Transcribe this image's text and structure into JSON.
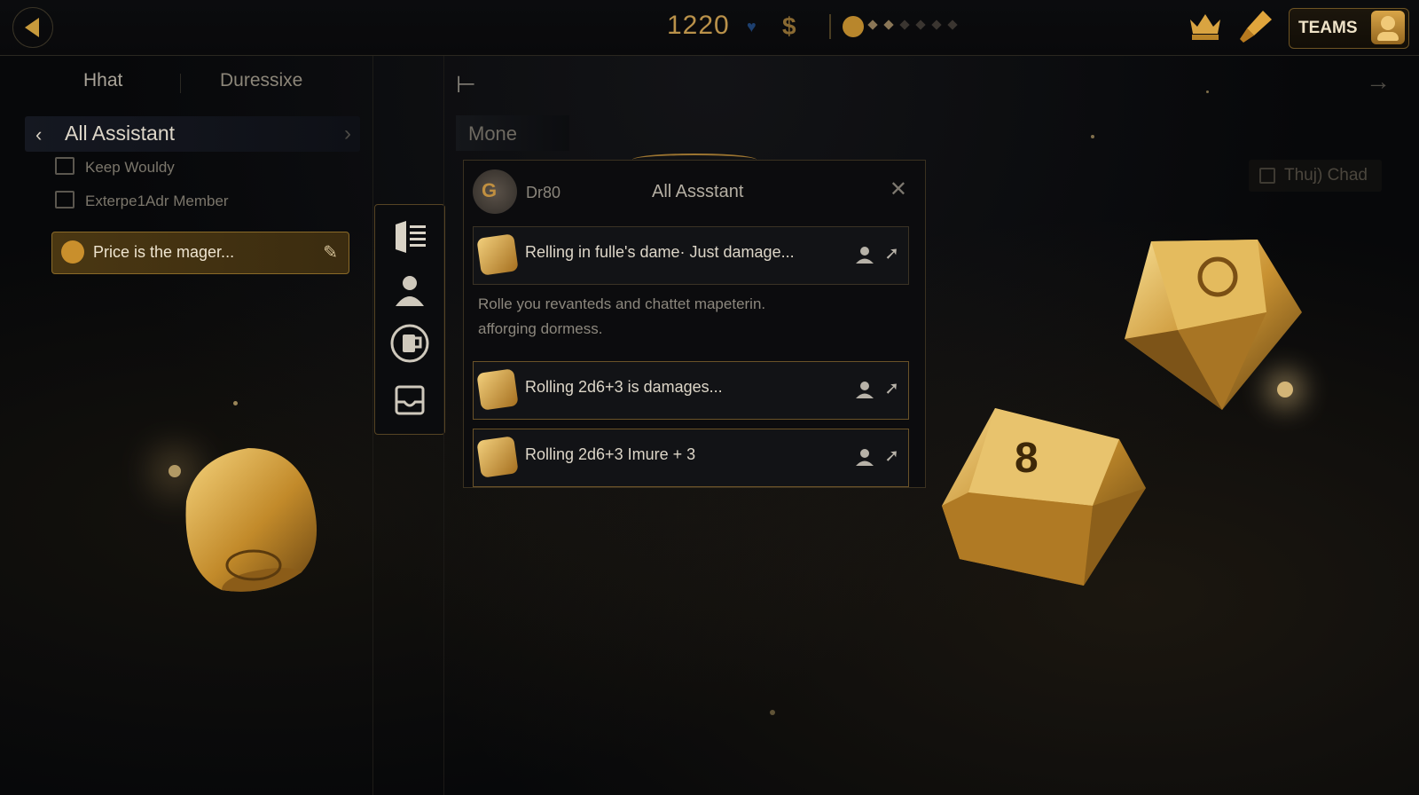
{
  "topbar": {
    "score": "1220",
    "icons": [
      "back-icon",
      "heart-icon",
      "dollar-icon",
      "face-icon",
      "crown-icon",
      "brush-icon"
    ],
    "teams_label": "TEAMS"
  },
  "sidebar": {
    "tabs": [
      "Hhat",
      "Duressixe"
    ],
    "assistant_title": "All Assistant",
    "items": [
      {
        "label": "Keep Wouldy"
      },
      {
        "label": "Exterpe1Adr Member"
      }
    ],
    "highlight": "Price is the mager..."
  },
  "main": {
    "mone": "Mone",
    "thuj": "Thuj) Chad"
  },
  "chat": {
    "user": "Dr80",
    "title": "All Assstant",
    "messages": [
      {
        "text": "Relling in fulle's dame· Just damage..."
      },
      {
        "text": "Rolling 2d6+3 is damages..."
      },
      {
        "text": "Rolling 2d6+3 Imure + 3"
      }
    ],
    "body_line1": "Rolle you revanteds and chattet mapeterin.",
    "body_line2": "afforging dormess."
  },
  "colors": {
    "accent": "#c79a3c",
    "background": "#07080a",
    "panel_border": "#564424"
  }
}
